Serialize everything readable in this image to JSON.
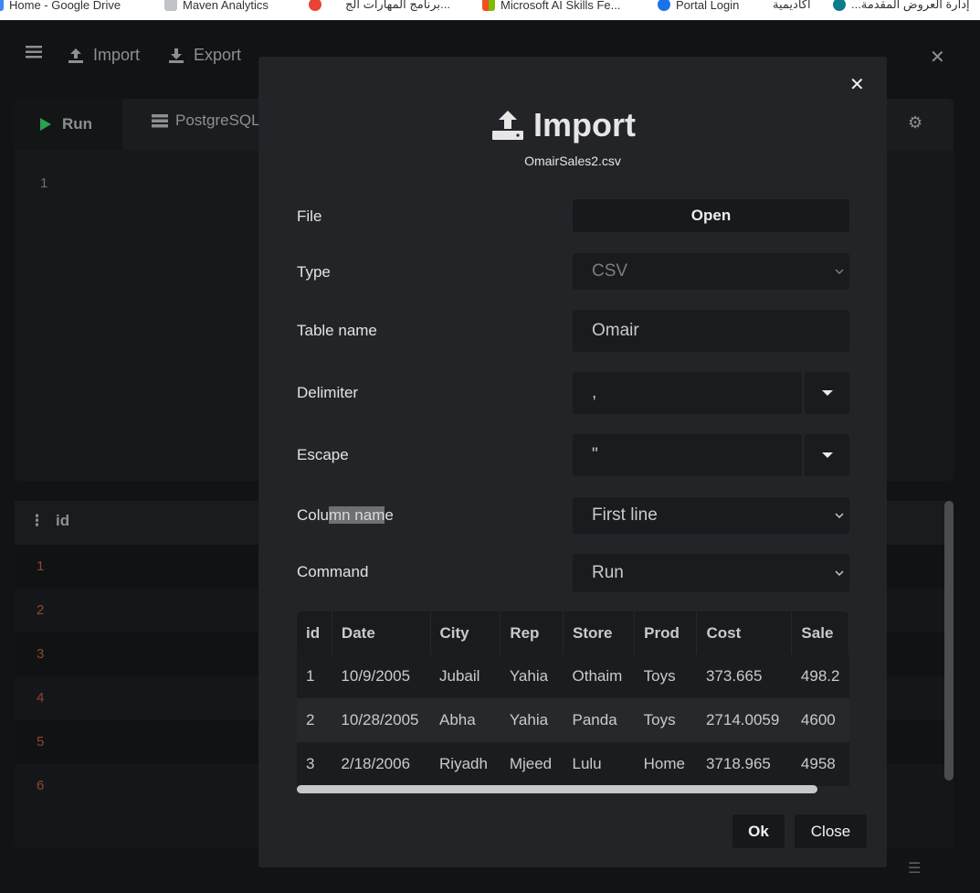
{
  "browser": {
    "bookmarks": [
      {
        "label": "Home - Google Drive",
        "icon": "google-drive-icon",
        "color": "#4285f4"
      },
      {
        "label": "Maven Analytics",
        "icon": "maven-icon",
        "color": "#9aa0a6"
      },
      {
        "label": "",
        "icon": "google-cloud-icon",
        "color": "#ea4335"
      },
      {
        "label": "برنامج المهارات الج...",
        "icon": "bookmark-icon",
        "color": "#888888"
      },
      {
        "label": "Microsoft AI Skills Fe...",
        "icon": "microsoft-icon",
        "color": "#f25022"
      },
      {
        "label": "Portal Login",
        "icon": "portal-icon",
        "color": "#1a73e8"
      },
      {
        "label": "أكاديمية",
        "icon": "bookmark-icon",
        "color": "#888888"
      },
      {
        "label": "...إدارة العروض المقدمة",
        "icon": "edge-icon",
        "color": "#0a7c8c"
      }
    ]
  },
  "app": {
    "toolbar": {
      "menu_icon": "hamburger-icon",
      "import_label": "Import",
      "export_label": "Export"
    },
    "editor": {
      "run_label": "Run",
      "db_label": "PostgreSQL",
      "line_number": "1"
    },
    "results": {
      "column": "id",
      "rows": [
        "1",
        "2",
        "3",
        "4",
        "5",
        "6"
      ]
    }
  },
  "modal": {
    "title": "Import",
    "filename": "OmairSales2.csv",
    "labels": {
      "file": "File",
      "type": "Type",
      "table_name": "Table name",
      "delimiter": "Delimiter",
      "escape": "Escape",
      "column_name_pre": "Colu",
      "column_name_sel": "mn nam",
      "column_name_post": "e",
      "command": "Command"
    },
    "fields": {
      "file_button": "Open",
      "type_value": "CSV",
      "table_name_value": "Omair",
      "delimiter_value": ",",
      "escape_value": "\"",
      "column_name_value": "First line",
      "command_value": "Run"
    },
    "preview": {
      "columns": [
        "id",
        "Date",
        "City",
        "Rep",
        "Store",
        "Prod",
        "Cost",
        "Sale"
      ],
      "rows": [
        [
          "1",
          "10/9/2005",
          "Jubail",
          "Yahia",
          "Othaim",
          "Toys",
          "373.665",
          "498.2"
        ],
        [
          "2",
          "10/28/2005",
          "Abha",
          "Yahia",
          "Panda",
          "Toys",
          "2714.0059",
          "4600"
        ],
        [
          "3",
          "2/18/2006",
          "Riyadh",
          "Mjeed",
          "Lulu",
          "Home",
          "3718.965",
          "4958"
        ]
      ]
    },
    "ok_label": "Ok",
    "close_label": "Close"
  }
}
